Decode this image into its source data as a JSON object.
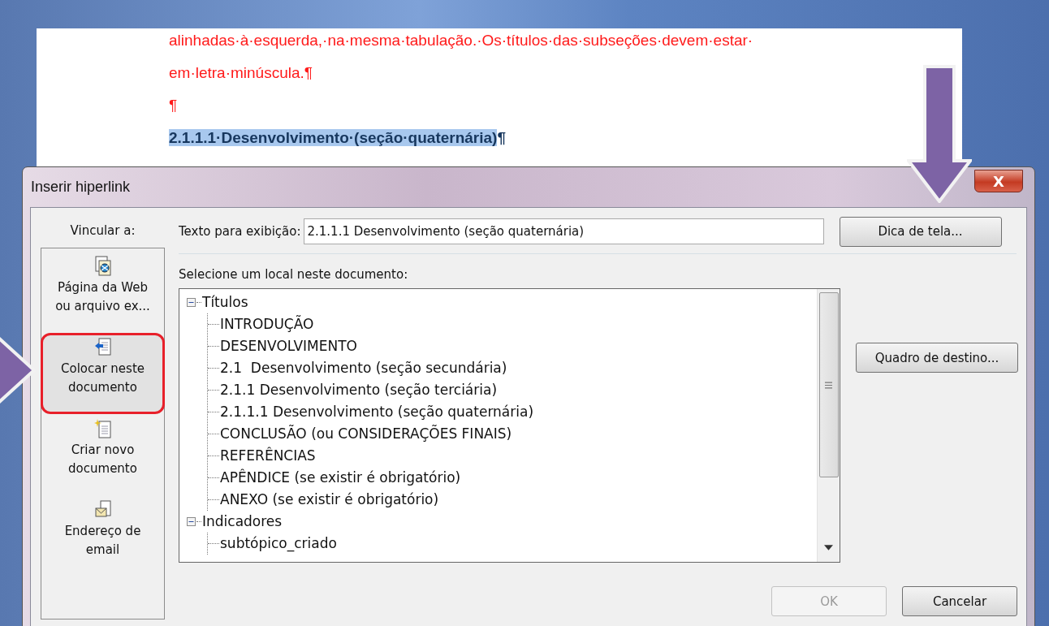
{
  "document": {
    "lines": [
      {
        "text": "alinhadas·à·esquerda,·na·mesma·tabulação.·Os·títulos·das·subseções·devem·estar·",
        "kind": "body"
      },
      {
        "text": "em·letra·minúscula.¶",
        "kind": "body"
      },
      {
        "text": "¶",
        "kind": "body"
      },
      {
        "text": "2.1.1.1·Desenvolvimento·(seção·quaternária)",
        "mark": "¶",
        "kind": "heading",
        "selected": true
      }
    ]
  },
  "dialog": {
    "title": "Inserir hiperlink",
    "close": "X",
    "link_to": {
      "label": "Vincular a:",
      "items": [
        {
          "label": "Página da Web ou arquivo ex...",
          "kind": "web",
          "selected": false
        },
        {
          "label": "Colocar neste documento",
          "kind": "place",
          "selected": true
        },
        {
          "label": "Criar novo documento",
          "kind": "new",
          "selected": false
        },
        {
          "label": "Endereço de email",
          "kind": "mail",
          "selected": false
        }
      ]
    },
    "display_text": {
      "label": "Texto para exibição:",
      "value": "2.1.1.1 Desenvolvimento (seção quaternária)"
    },
    "tooltip_button": "Dica de tela...",
    "tree_label": "Selecione um local neste documento:",
    "tree": [
      {
        "label": "Títulos",
        "expanded": true,
        "children": [
          {
            "label": "INTRODUÇÃO"
          },
          {
            "label": "DESENVOLVIMENTO"
          },
          {
            "label": "2.1  Desenvolvimento (seção secundária)"
          },
          {
            "label": "2.1.1 Desenvolvimento (seção terciária)"
          },
          {
            "label": "2.1.1.1 Desenvolvimento (seção quaternária)"
          },
          {
            "label": "CONCLUSÃO (ou CONSIDERAÇÕES FINAIS)"
          },
          {
            "label": "REFERÊNCIAS"
          },
          {
            "label": "APÊNDICE (se existir é obrigatório)"
          },
          {
            "label": "ANEXO (se existir é obrigatório)"
          }
        ]
      },
      {
        "label": "Indicadores",
        "expanded": true,
        "children": [
          {
            "label": "subtópico_criado"
          }
        ]
      }
    ],
    "frame_button": "Quadro de destino...",
    "ok_button": {
      "label": "OK",
      "disabled": true
    },
    "cancel_button": {
      "label": "Cancelar",
      "disabled": false
    }
  }
}
